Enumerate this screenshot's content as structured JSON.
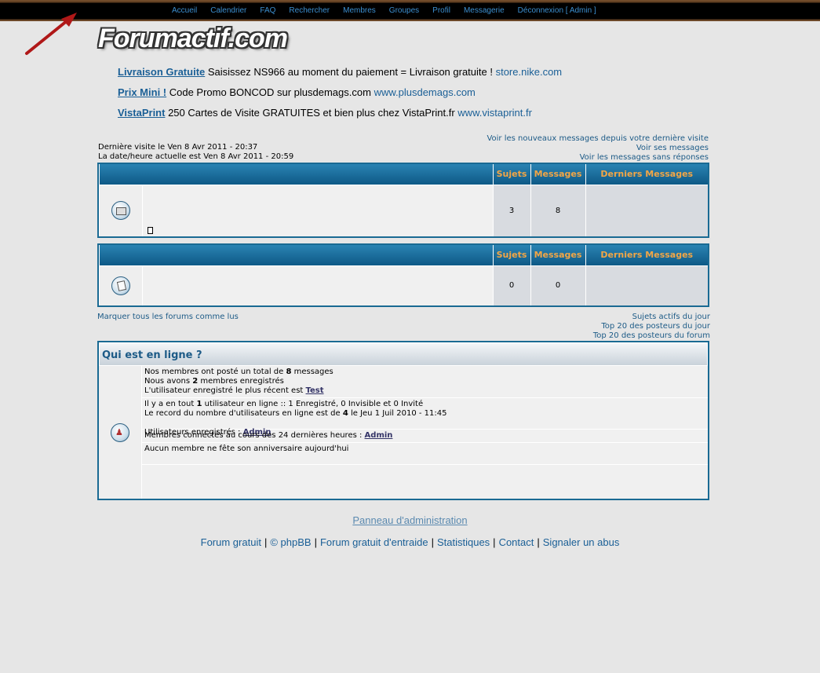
{
  "topnav": [
    "Accueil",
    "Calendrier",
    "FAQ",
    "Rechercher",
    "Membres",
    "Groupes",
    "Profil",
    "Messagerie",
    "Déconnexion [ Admin ]"
  ],
  "logo": "Forumactif.com",
  "ads": [
    {
      "title": "Livraison Gratuite",
      "text": " Saisissez NS966 au moment du paiement = Livraison gratuite ! ",
      "url": "store.nike.com"
    },
    {
      "title": "Prix Mini !",
      "text": " Code Promo BONCOD sur plusdemags.com ",
      "url": "www.plusdemags.com"
    },
    {
      "title": "VistaPrint",
      "text": " 250 Cartes de Visite GRATUITES et bien plus chez VistaPrint.fr ",
      "url": "www.vistaprint.fr"
    }
  ],
  "visit": {
    "last": "Dernière visite le Ven 8 Avr 2011 - 20:37",
    "current": "La date/heure actuelle est Ven 8 Avr 2011 - 20:59"
  },
  "links_right": [
    "Voir les nouveaux messages depuis votre dernière visite",
    "Voir ses messages",
    "Voir les messages sans réponses"
  ],
  "table_headers": {
    "subjects": "Sujets",
    "messages": "Messages",
    "last": "Derniers Messages"
  },
  "forum1": {
    "subjects": "3",
    "messages": "8"
  },
  "forum2": {
    "subjects": "0",
    "messages": "0"
  },
  "mark_read": "Marquer tous les forums comme lus",
  "bottom_links": [
    "Sujets actifs du jour",
    "Top 20 des posteurs du jour",
    "Top 20 des posteurs du forum"
  ],
  "online": {
    "title": "Qui est en ligne ?",
    "posted_pre": "Nos membres ont posté un total de ",
    "posted_num": "8",
    "posted_post": " messages",
    "members_pre": "Nous avons ",
    "members_num": "2",
    "members_post": " membres enregistrés",
    "newest_pre": "L'utilisateur enregistré le plus récent est ",
    "newest_user": "Test",
    "total_pre": "Il y a en tout ",
    "total_num": "1",
    "total_post": " utilisateur en ligne :: 1 Enregistré, 0 Invisible et 0 Invité",
    "record_pre": "Le record du nombre d'utilisateurs en ligne est de ",
    "record_num": "4",
    "record_post": " le Jeu 1 Juil 2010 - 11:45",
    "registered_label": "Utilisateurs enregistrés : ",
    "registered_user": "Admin",
    "last24_label": "Membres connectés au cours des 24 dernières heures : ",
    "last24_user": "Admin",
    "birthday": "Aucun membre ne fête son anniversaire aujourd'hui"
  },
  "admin_panel": "Panneau d'administration",
  "footer": [
    "Forum gratuit",
    "© phpBB",
    "Forum gratuit d'entraide",
    "Statistiques",
    "Contact",
    "Signaler un abus"
  ]
}
